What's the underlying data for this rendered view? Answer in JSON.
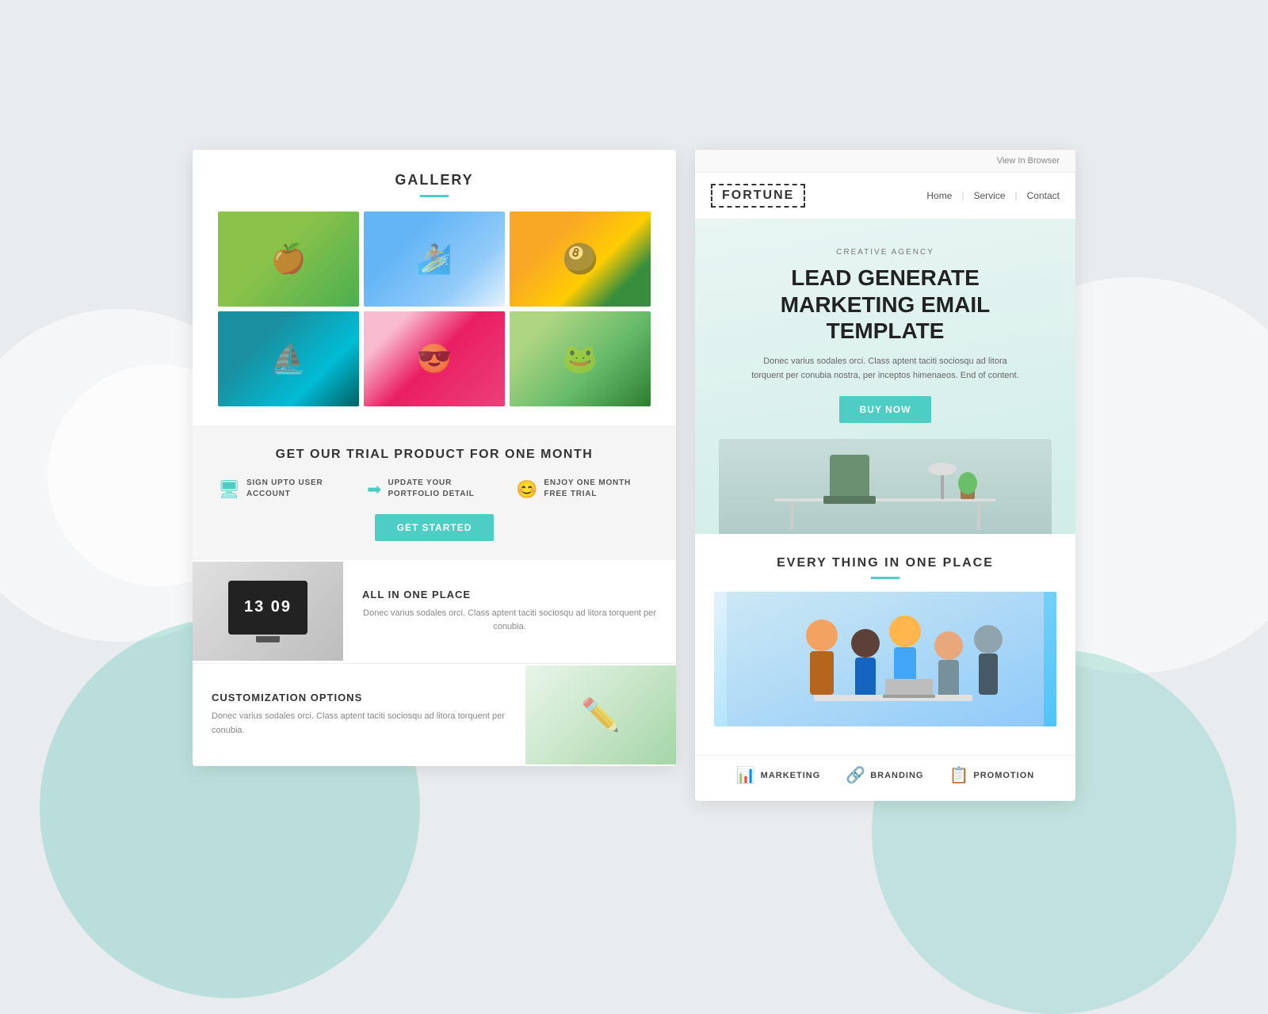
{
  "background": {
    "color": "#e8ecef"
  },
  "left_panel": {
    "gallery": {
      "title": "GALLERY",
      "underline_color": "#4ecdc4",
      "images": [
        {
          "id": 1,
          "alt": "green-apples-faucet",
          "class": "gallery-item-1",
          "icon": "🍎"
        },
        {
          "id": 2,
          "alt": "surfer",
          "class": "gallery-item-2",
          "icon": "🏄"
        },
        {
          "id": 3,
          "alt": "billiard-balls",
          "class": "gallery-item-3",
          "icon": "🎱"
        },
        {
          "id": 4,
          "alt": "boats-water",
          "class": "gallery-item-4",
          "icon": "⛵"
        },
        {
          "id": 5,
          "alt": "child-sunglasses",
          "class": "gallery-item-5",
          "icon": "😎"
        },
        {
          "id": 6,
          "alt": "frog-leaf",
          "class": "gallery-item-6",
          "icon": "🐸"
        }
      ]
    },
    "trial": {
      "title": "GET OUR TRIAL PRODUCT FOR ONE MONTH",
      "steps": [
        {
          "icon": "🖥",
          "text": "SIGN UPTO USER ACCOUNT"
        },
        {
          "icon": "➡",
          "text": "UPDATE YOUR PORTFOLIO DETAIL"
        },
        {
          "icon": "😊",
          "text": "ENJOY ONE MONTH FREE TRIAL"
        }
      ],
      "button_label": "GET STARTED",
      "button_color": "#4ecdc4"
    },
    "all_in_one": {
      "title": "ALL IN ONE PLACE",
      "time_display": "13 09",
      "description": "Donec varius sodales orci. Class aptent taciti sociosqu ad litora torquent per conubia."
    },
    "customization": {
      "title": "CUSTOMIZATION OPTIONS",
      "description": "Donec varius sodales orci. Class aptent taciti sociosqu ad litora torquent per conubia."
    }
  },
  "right_panel": {
    "top_bar": {
      "label": "View In Browser"
    },
    "nav": {
      "logo": "FORTUNE",
      "links": [
        "Home",
        "Service",
        "Contact"
      ]
    },
    "hero": {
      "tag": "CREATIVE AGENCY",
      "title": "LEAD GENERATE MARKETING EMAIL TEMPLATE",
      "description": "Donec varius sodales orci. Class aptent taciti sociosqu ad litora torquent per conubia nostra, per inceptos himenaeos. End of content.",
      "button_label": "BUY NOW",
      "button_color": "#4ecdc4"
    },
    "everything": {
      "title": "EVERY THING IN ONE PLACE",
      "underline_color": "#4ecdc4"
    },
    "bottom_icons": [
      {
        "icon": "📊",
        "label": "MARKETING"
      },
      {
        "icon": "🔗",
        "label": "BRANDING"
      },
      {
        "icon": "📋",
        "label": "PROMOTION"
      }
    ]
  }
}
